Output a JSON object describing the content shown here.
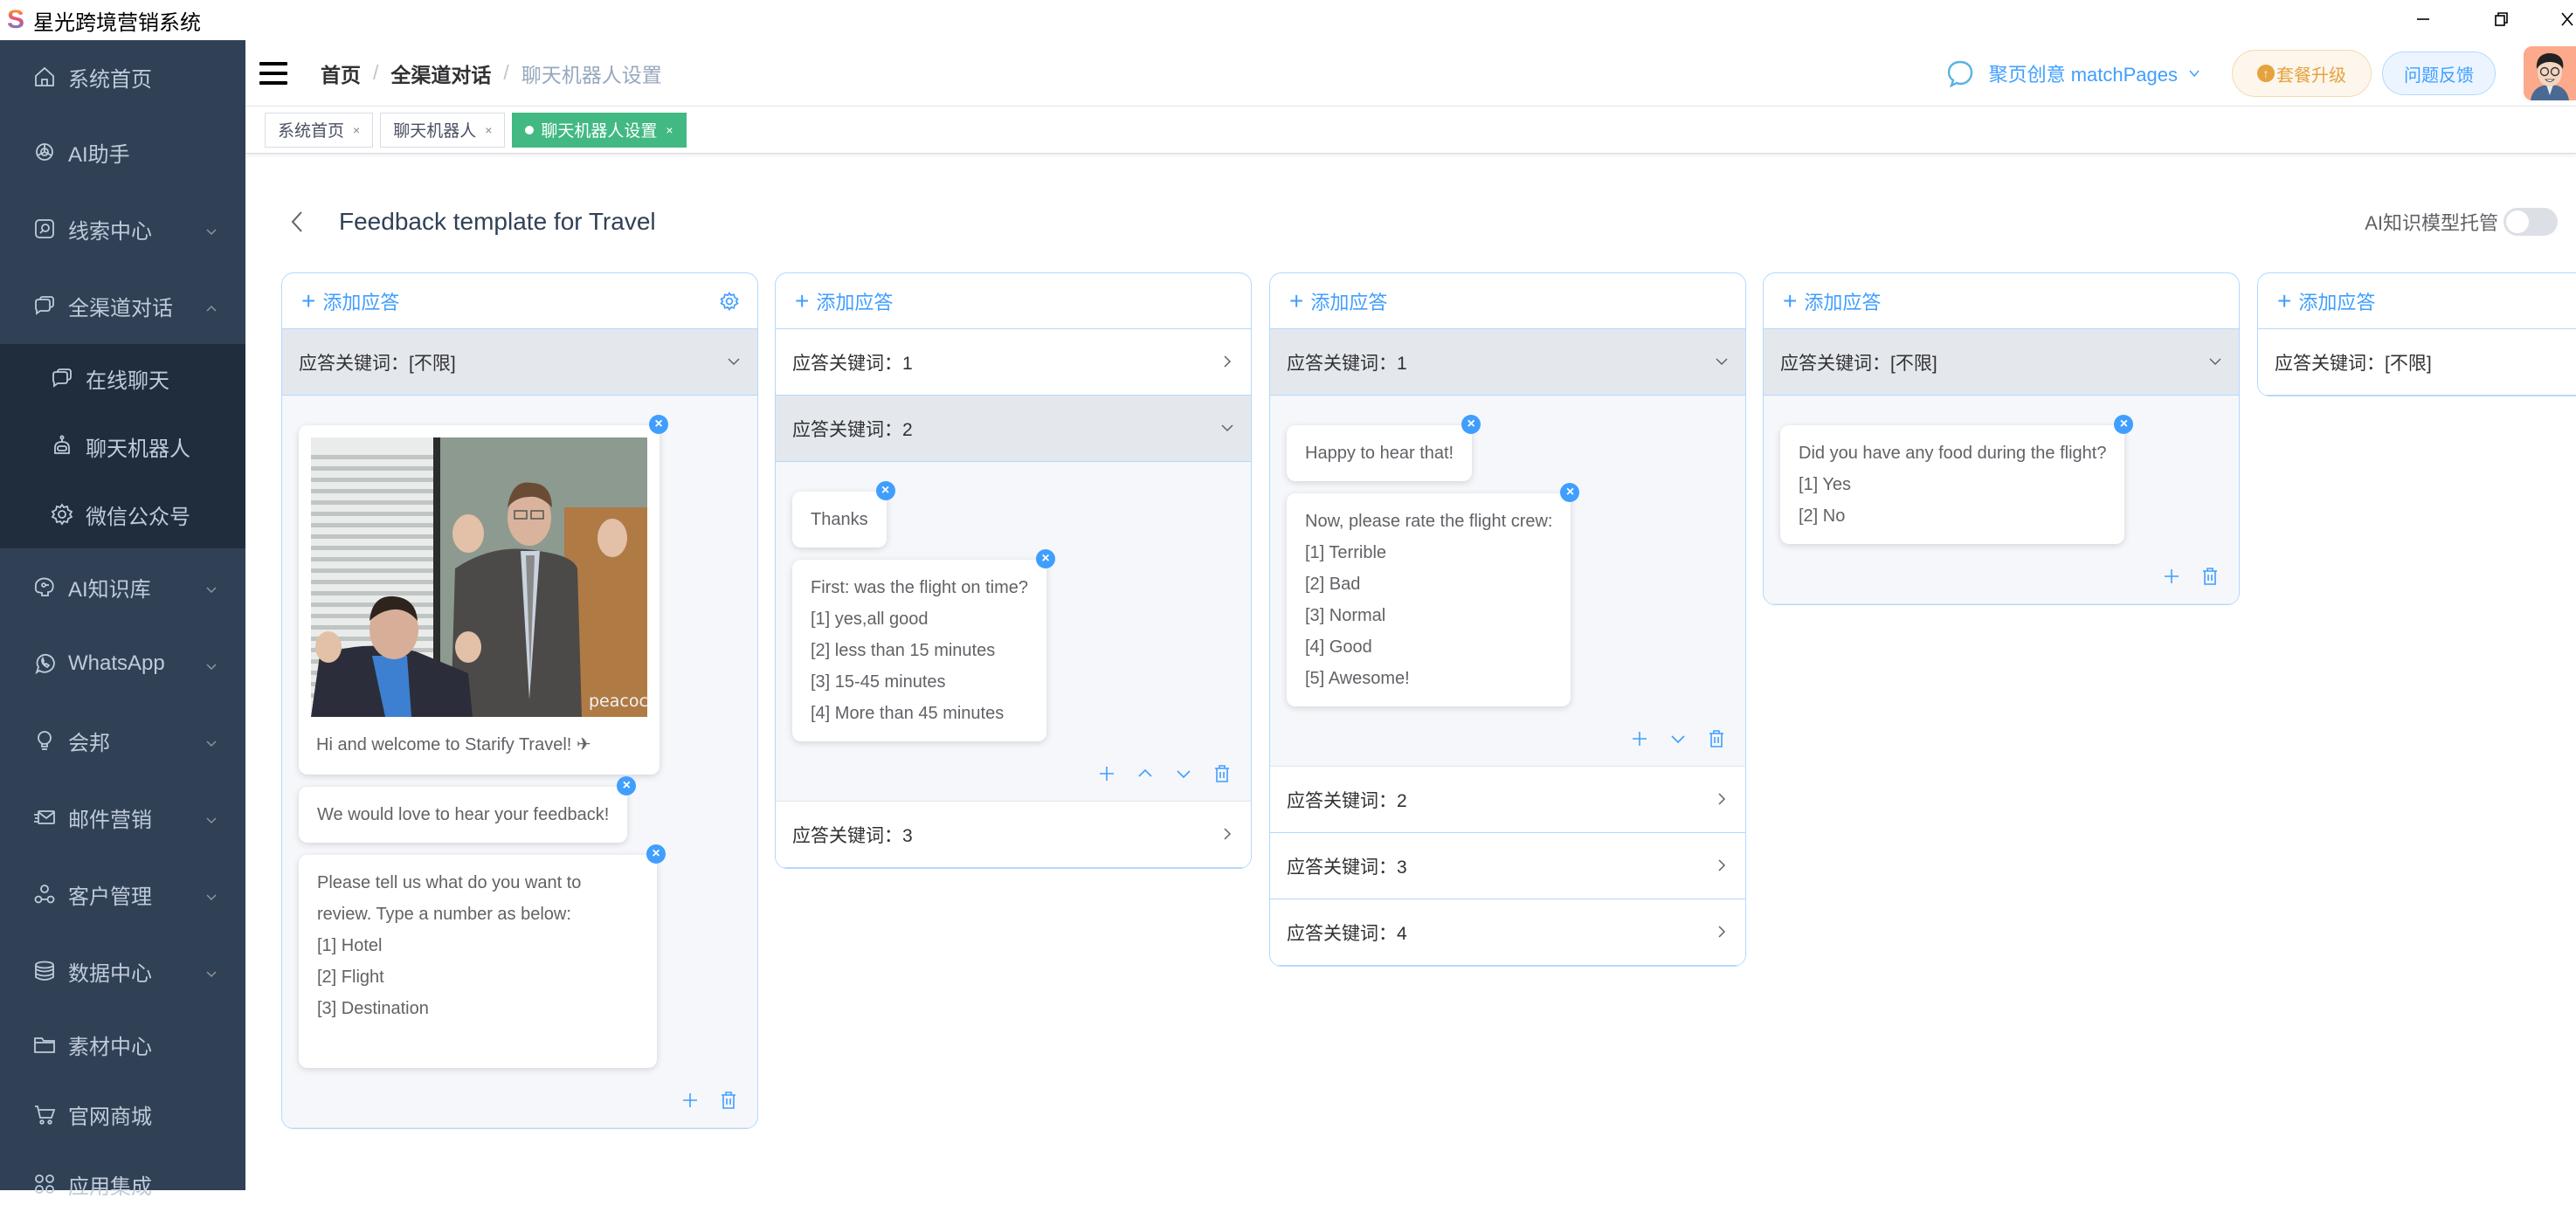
{
  "window": {
    "app_title": "星光跨境营销系统",
    "controls": [
      "minimize",
      "restore",
      "close"
    ]
  },
  "sidebar": {
    "items": [
      {
        "label": "系统首页",
        "icon": "home-icon",
        "has_arrow": false
      },
      {
        "label": "AI助手",
        "icon": "openai-icon",
        "has_arrow": false
      },
      {
        "label": "线索中心",
        "icon": "search-box-icon",
        "has_arrow": true,
        "expanded": false
      },
      {
        "label": "全渠道对话",
        "icon": "chat-bubbles-icon",
        "has_arrow": true,
        "expanded": true,
        "children": [
          {
            "label": "在线聊天",
            "icon": "chat-bubbles-icon"
          },
          {
            "label": "聊天机器人",
            "icon": "robot-icon"
          },
          {
            "label": "微信公众号",
            "icon": "gear-icon"
          }
        ]
      },
      {
        "label": "AI知识库",
        "icon": "brain-icon",
        "has_arrow": true,
        "expanded": false
      },
      {
        "label": "WhatsApp",
        "icon": "whatsapp-icon",
        "has_arrow": true,
        "expanded": false
      },
      {
        "label": "会邦",
        "icon": "lightbulb-icon",
        "has_arrow": true,
        "expanded": false
      },
      {
        "label": "邮件营销",
        "icon": "mail-icon",
        "has_arrow": true,
        "expanded": false
      },
      {
        "label": "客户管理",
        "icon": "users-icon",
        "has_arrow": true,
        "expanded": false
      },
      {
        "label": "数据中心",
        "icon": "database-icon",
        "has_arrow": true,
        "expanded": false
      },
      {
        "label": "素材中心",
        "icon": "folder-icon",
        "has_arrow": false
      },
      {
        "label": "官网商城",
        "icon": "cart-icon",
        "has_arrow": false
      },
      {
        "label": "应用集成",
        "icon": "apps-icon",
        "has_arrow": false
      }
    ]
  },
  "header": {
    "breadcrumb": [
      "首页",
      "全渠道对话",
      "聊天机器人设置"
    ],
    "team_selector": "聚页创意 matchPages",
    "upgrade_label": "套餐升级",
    "feedback_label": "问题反馈"
  },
  "tabs": [
    {
      "label": "系统首页",
      "active": false
    },
    {
      "label": "聊天机器人",
      "active": false
    },
    {
      "label": "聊天机器人设置",
      "active": true
    }
  ],
  "page": {
    "title": "Feedback template for Travel",
    "toggle_label": "AI知识模型托管",
    "toggle_on": false
  },
  "colors": {
    "sidebar_bg": "#304156",
    "submenu_bg": "#1f2d3d",
    "accent": "#409eff",
    "active_tag": "#42b983",
    "upgrade": "#e6a23c"
  },
  "columns": [
    {
      "add_label": "添加应答",
      "has_settings": true,
      "keywords": [
        {
          "label": "应答关键词：[不限]",
          "open": true,
          "messages": [
            {
              "type": "image",
              "caption": "Hi and welcome to Starify Travel! ✈",
              "watermark": "peacock"
            },
            {
              "type": "text",
              "lines": [
                "We would love to hear your feedback!"
              ]
            },
            {
              "type": "text",
              "lines": [
                "Please tell us what do you want to",
                "review. Type a number as below:",
                "[1] Hotel",
                "[2] Flight",
                "[3] Destination",
                ""
              ]
            }
          ],
          "actions": [
            "add",
            "delete"
          ]
        }
      ]
    },
    {
      "add_label": "添加应答",
      "has_settings": false,
      "keywords": [
        {
          "label": "应答关键词：1",
          "open": false
        },
        {
          "label": "应答关键词：2",
          "open": true,
          "messages": [
            {
              "type": "text",
              "lines": [
                "Thanks"
              ]
            },
            {
              "type": "text",
              "lines": [
                "First: was the flight on time?",
                "[1] yes,all good",
                "[2] less than 15 minutes",
                "[3] 15-45 minutes",
                "[4] More than 45 minutes"
              ]
            }
          ],
          "actions": [
            "add",
            "move-up",
            "move-down",
            "delete"
          ]
        },
        {
          "label": "应答关键词：3",
          "open": false
        }
      ]
    },
    {
      "add_label": "添加应答",
      "has_settings": false,
      "keywords": [
        {
          "label": "应答关键词：1",
          "open": true,
          "messages": [
            {
              "type": "text",
              "lines": [
                "Happy to hear that!"
              ]
            },
            {
              "type": "text",
              "lines": [
                "Now, please rate the flight crew:",
                "[1] Terrible",
                "[2] Bad",
                "[3] Normal",
                "[4] Good",
                "[5] Awesome!"
              ]
            }
          ],
          "actions": [
            "add",
            "move-down",
            "delete"
          ]
        },
        {
          "label": "应答关键词：2",
          "open": false
        },
        {
          "label": "应答关键词：3",
          "open": false
        },
        {
          "label": "应答关键词：4",
          "open": false
        }
      ]
    },
    {
      "add_label": "添加应答",
      "has_settings": false,
      "keywords": [
        {
          "label": "应答关键词：[不限]",
          "open": true,
          "messages": [
            {
              "type": "text",
              "lines": [
                "Did you have any food during the flight?",
                "[1] Yes",
                "[2] No"
              ]
            }
          ],
          "actions": [
            "add",
            "delete"
          ]
        }
      ]
    },
    {
      "add_label": "添加应答",
      "has_settings": false,
      "keywords": [
        {
          "label": "应答关键词：[不限]",
          "open": false,
          "no_chevron": true
        }
      ]
    }
  ]
}
